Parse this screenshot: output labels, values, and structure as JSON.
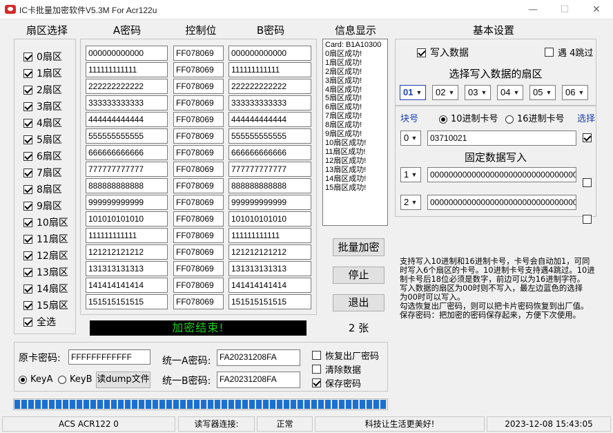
{
  "window": {
    "title": "IC卡批量加密软件V5.3M For Acr122u",
    "min_glyph": "—",
    "max_glyph": "☐",
    "close_glyph": "✕"
  },
  "sector_select": {
    "header": "扇区选择",
    "items": [
      "0扇区",
      "1扇区",
      "2扇区",
      "3扇区",
      "4扇区",
      "5扇区",
      "6扇区",
      "7扇区",
      "8扇区",
      "9扇区",
      "10扇区",
      "11扇区",
      "12扇区",
      "13扇区",
      "14扇区",
      "15扇区"
    ],
    "all_label": "全选"
  },
  "keys": {
    "col_a": "A密码",
    "col_ctrl": "控制位",
    "col_b": "B密码",
    "rows": [
      {
        "a": "000000000000",
        "c": "FF078069",
        "b": "000000000000"
      },
      {
        "a": "111111111111",
        "c": "FF078069",
        "b": "111111111111"
      },
      {
        "a": "222222222222",
        "c": "FF078069",
        "b": "222222222222"
      },
      {
        "a": "333333333333",
        "c": "FF078069",
        "b": "333333333333"
      },
      {
        "a": "444444444444",
        "c": "FF078069",
        "b": "444444444444"
      },
      {
        "a": "555555555555",
        "c": "FF078069",
        "b": "555555555555"
      },
      {
        "a": "666666666666",
        "c": "FF078069",
        "b": "666666666666"
      },
      {
        "a": "777777777777",
        "c": "FF078069",
        "b": "777777777777"
      },
      {
        "a": "888888888888",
        "c": "FF078069",
        "b": "888888888888"
      },
      {
        "a": "999999999999",
        "c": "FF078069",
        "b": "999999999999"
      },
      {
        "a": "101010101010",
        "c": "FF078069",
        "b": "101010101010"
      },
      {
        "a": "111111111111",
        "c": "FF078069",
        "b": "111111111111"
      },
      {
        "a": "121212121212",
        "c": "FF078069",
        "b": "121212121212"
      },
      {
        "a": "131313131313",
        "c": "FF078069",
        "b": "131313131313"
      },
      {
        "a": "141414141414",
        "c": "FF078069",
        "b": "141414141414"
      },
      {
        "a": "151515151515",
        "c": "FF078069",
        "b": "151515151515"
      }
    ]
  },
  "status_banner": {
    "text": "加密结束!",
    "color": "#18d018",
    "bg": "#000000"
  },
  "info": {
    "header": "信息显示",
    "lines": [
      "Card: B1A10300",
      "0扇区成功!",
      "1扇区成功!",
      "2扇区成功!",
      "3扇区成功!",
      "4扇区成功!",
      "5扇区成功!",
      "6扇区成功!",
      "7扇区成功!",
      "8扇区成功!",
      "9扇区成功!",
      "10扇区成功!",
      "11扇区成功!",
      "12扇区成功!",
      "13扇区成功!",
      "14扇区成功!",
      "15扇区成功!"
    ]
  },
  "actions": {
    "batch": "批量加密",
    "stop": "停止",
    "exit": "退出",
    "count": "2 张"
  },
  "settings": {
    "header": "基本设置",
    "write_data": "写入数据",
    "skip4": "遇 4跳过",
    "choose_sector": "选择写入数据的扇区",
    "sectors": [
      "01",
      "02",
      "03",
      "04",
      "05",
      "06"
    ],
    "block_label": "块号",
    "dec_label": "10进制卡号",
    "hex_label": "16进制卡号",
    "select_label": "选择",
    "block_value": "0",
    "card_no": "03710021",
    "fixed_header": "固定数据写入",
    "fixed": [
      {
        "block": "1",
        "value": "00000000000000000000000000000000"
      },
      {
        "block": "2",
        "value": "00000000000000000000000000000000"
      }
    ],
    "accent": "#1a3fb0"
  },
  "help": {
    "lines": [
      "支持写入10进制和16进制卡号，卡号会自动加1，可同",
      "时写入6个扇区的卡号。10进制卡号支持遇4跳过。10进",
      "制卡号后18位必须是数字，前边可以为16进制字符。",
      "写入数据的扇区为00时则不写入，最左边蓝色的选择",
      "为00时可以写入。",
      "勾选恢复出厂密码，则可以把卡片密码恢复到出厂值。",
      "保存密码：把加密的密码保存起来，方便下次使用。"
    ]
  },
  "bottom": {
    "orig_label": "原卡密码:",
    "orig_value": "FFFFFFFFFFFF",
    "keya": "KeyA",
    "keyb": "KeyB",
    "dump_btn": "读dump文件",
    "unify_a_label": "统一A密码:",
    "unify_a": "FA20231208FA",
    "unify_b_label": "统一B密码:",
    "unify_b": "FA20231208FA",
    "restore": "恢复出厂密码",
    "clear": "清除数据",
    "save": "保存密码"
  },
  "progress": {
    "fraction": 1.0,
    "color": "#1a6fd0"
  },
  "statusbar": {
    "reader": "ACS ACR122 0",
    "conn_label": "读写器连接:",
    "conn_state": "正常",
    "slogan": "科技让生活更美好!",
    "datetime": "2023-12-08 15:43:05"
  }
}
